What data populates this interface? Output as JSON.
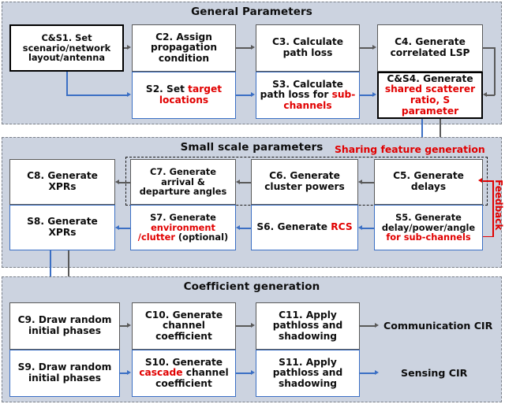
{
  "diagram": {
    "title_note": "Channel model procedure flowchart",
    "sections": [
      {
        "id": "general",
        "title": "General Parameters"
      },
      {
        "id": "small_scale",
        "title": "Small scale parameters"
      },
      {
        "id": "coefficient",
        "title": "Coefficient generation"
      }
    ]
  },
  "general": {
    "cs1": {
      "l1": "C&S1. Set",
      "l2": "scenario/network",
      "l3": "layout/antenna"
    },
    "c2": {
      "l1": "C2. Assign",
      "l2": "propagation",
      "l3": "condition"
    },
    "c3": {
      "l1": "C3. Calculate",
      "l2": "path loss"
    },
    "c4": {
      "l1": "C4. Generate",
      "l2": "correlated LSP"
    },
    "s2": {
      "p1": "S2. Set ",
      "p2": "target",
      "p3": "locations"
    },
    "s3": {
      "p1": "S3. Calculate",
      "p2": "path loss for ",
      "p3": "sub-",
      "p4": "channels"
    },
    "cs4": {
      "p1": "C&S4. Generate",
      "p2": "shared scatterer",
      "p3": "ratio, S parameter"
    }
  },
  "small_scale": {
    "note_sharing": "Sharing feature generation",
    "note_feedback": "Feedback",
    "c8": {
      "l1": "C8. Generate",
      "l2": "XPRs"
    },
    "c7": {
      "l1": "C7. Generate",
      "l2": "arrival &",
      "l3": "departure angles"
    },
    "c6": {
      "l1": "C6. Generate",
      "l2": "cluster powers"
    },
    "c5": {
      "l1": "C5. Generate",
      "l2": "delays"
    },
    "s8": {
      "l1": "S8. Generate",
      "l2": "XPRs"
    },
    "s7": {
      "p1": "S7. Generate",
      "p2": "environment",
      "p3": "/clutter",
      "p4": " (optional)"
    },
    "s6": {
      "p1": "S6. Generate ",
      "p2": "RCS"
    },
    "s5": {
      "p1": "S5. Generate",
      "p2": "delay/power/angle",
      "p3": "for sub-channels"
    }
  },
  "coefficient": {
    "c9": {
      "l1": "C9. Draw random",
      "l2": "initial phases"
    },
    "c10": {
      "l1": "C10. Generate",
      "l2": "channel",
      "l3": "coefficient"
    },
    "c11": {
      "l1": "C11. Apply",
      "l2": "pathloss and",
      "l3": "shadowing"
    },
    "s9": {
      "l1": "S9. Draw random",
      "l2": "initial phases"
    },
    "s10": {
      "p1": "S10. Generate",
      "p2": "cascade",
      "p3": " channel",
      "p4": "coefficient"
    },
    "s11": {
      "l1": "S11. Apply",
      "l2": "pathloss and",
      "l3": "shadowing"
    },
    "out_comm": "Communication CIR",
    "out_sens": "Sensing CIR"
  },
  "colors": {
    "background": "#ccd3e0",
    "box_fill": "#ffffff",
    "comm_border": "#595959",
    "sens_border": "#3b6fc4",
    "highlight_red": "#e10000",
    "thick_border": "#000000"
  }
}
